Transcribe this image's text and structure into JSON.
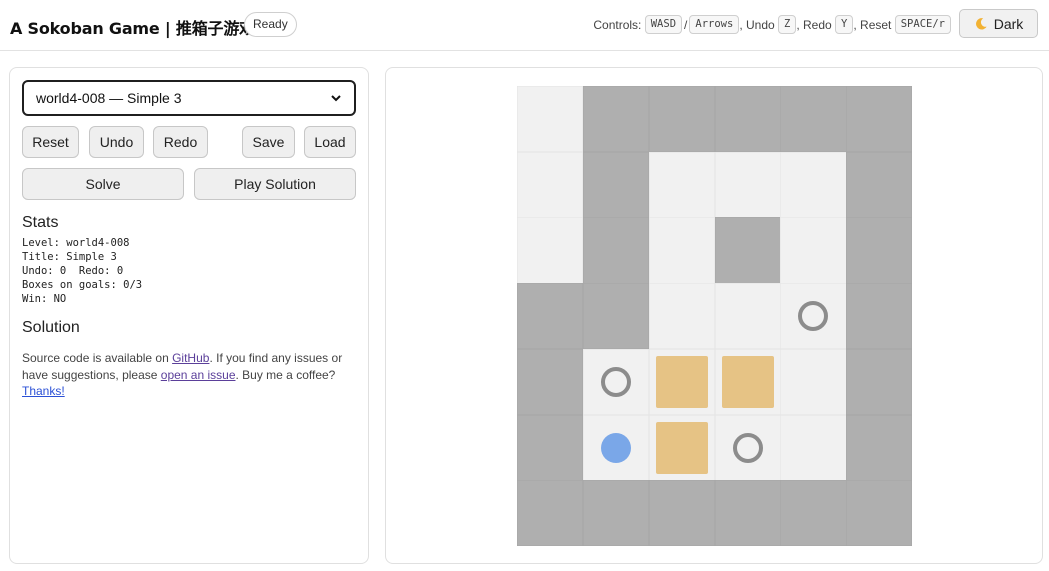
{
  "header": {
    "title": "A Sokoban Game | 推箱子游戏",
    "status": "Ready",
    "controls_label": "Controls:",
    "keys": {
      "move_wasd": "WASD",
      "slash": "/",
      "move_arrows": "Arrows",
      "undo_label": ", Undo",
      "undo_key": "Z",
      "redo_label": ", Redo",
      "redo_key": "Y",
      "reset_label": ", Reset",
      "reset_key": "SPACE/r"
    },
    "theme_button": "Dark",
    "theme_icon": "moon-icon"
  },
  "panel": {
    "level_select": "world4-008 — Simple 3",
    "buttons": {
      "reset": "Reset",
      "undo": "Undo",
      "redo": "Redo",
      "save": "Save",
      "load": "Load",
      "solve": "Solve",
      "play_solution": "Play Solution"
    },
    "stats_heading": "Stats",
    "stats": {
      "level": "Level: world4-008",
      "title": "Title: Simple 3",
      "undo_redo": "Undo: 0  Redo: 0",
      "boxes": "Boxes on goals: 0/3",
      "win": "Win: NO"
    },
    "solution_heading": "Solution",
    "footer": {
      "t1": "Source code is available on ",
      "github": "GitHub",
      "t2": ". If you find any issues or have suggestions, please ",
      "issue": "open an issue",
      "t3": ". Buy me a coffee? ",
      "thanks": "Thanks!"
    }
  },
  "board": {
    "rows": [
      "-#####",
      "-#---#",
      "-#-#-#",
      "##--.#",
      "#.$$-#",
      "#@$.-#",
      "######"
    ],
    "legend": {
      "#": "wall",
      "-": "floor",
      ".": "goal",
      "$": "box",
      "@": "player"
    },
    "colors": {
      "wall": "#afafaf",
      "floor": "#f1f1f1",
      "box": "#e6c385",
      "goal": "#8c8c8c",
      "player": "#7aa7e8"
    }
  }
}
